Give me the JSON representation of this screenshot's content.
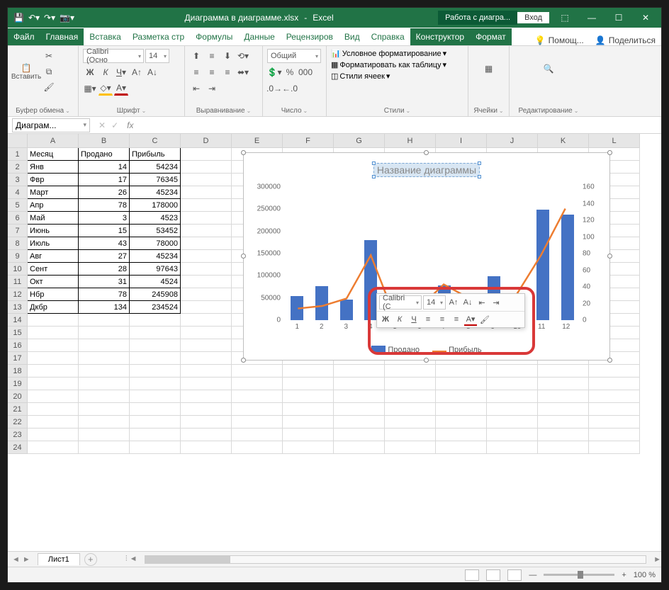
{
  "title": {
    "doc": "Диаграмма в диаграмме.xlsx",
    "app": "Excel",
    "context": "Работа с диагра...",
    "signin": "Вход"
  },
  "tabs": {
    "file": "Файл",
    "home": "Главная",
    "insert": "Вставка",
    "layout": "Разметка стр",
    "formulas": "Формулы",
    "data": "Данные",
    "review": "Рецензиров",
    "view": "Вид",
    "help": "Справка",
    "design": "Конструктор",
    "format": "Формат",
    "tell": "Помощ...",
    "share": "Поделиться"
  },
  "ribbon": {
    "clipboard": {
      "label": "Буфер обмена",
      "paste": "Вставить"
    },
    "font": {
      "label": "Шрифт",
      "name": "Calibri (Осно",
      "size": "14"
    },
    "align": {
      "label": "Выравнивание"
    },
    "number": {
      "label": "Число",
      "format": "Общий"
    },
    "styles": {
      "label": "Стили",
      "cond": "Условное форматирование",
      "table": "Форматировать как таблицу",
      "cell": "Стили ячеек"
    },
    "cells": {
      "label": "Ячейки"
    },
    "edit": {
      "label": "Редактирование"
    }
  },
  "namebox": "Диаграм...",
  "columns": [
    "A",
    "B",
    "C",
    "D",
    "E",
    "F",
    "G",
    "H",
    "I",
    "J",
    "K",
    "L"
  ],
  "table": {
    "headers": [
      "Месяц",
      "Продано",
      "Прибыль"
    ],
    "rows": [
      [
        "Янв",
        14,
        54234
      ],
      [
        "Фвр",
        17,
        76345
      ],
      [
        "Март",
        26,
        45234
      ],
      [
        "Апр",
        78,
        178000
      ],
      [
        "Май",
        3,
        4523
      ],
      [
        "Июнь",
        15,
        53452
      ],
      [
        "Июль",
        43,
        78000
      ],
      [
        "Авг",
        27,
        45234
      ],
      [
        "Сент",
        28,
        97643
      ],
      [
        "Окт",
        31,
        4524
      ],
      [
        "Нбр",
        78,
        245908
      ],
      [
        "Дкбр",
        134,
        234524
      ]
    ]
  },
  "chart_data": {
    "type": "combo",
    "title": "Название диаграммы",
    "x": [
      1,
      2,
      3,
      4,
      5,
      6,
      7,
      8,
      9,
      10,
      11,
      12
    ],
    "series": [
      {
        "name": "Продано",
        "type": "bar",
        "axis": "left",
        "values": [
          54234,
          76345,
          45234,
          178000,
          4523,
          53452,
          78000,
          45234,
          97643,
          4524,
          245908,
          234524
        ]
      },
      {
        "name": "Прибыль",
        "type": "line",
        "axis": "right",
        "values": [
          14,
          17,
          26,
          78,
          3,
          15,
          43,
          27,
          28,
          31,
          78,
          134
        ]
      }
    ],
    "y_left": {
      "min": 0,
      "max": 300000,
      "ticks": [
        0,
        50000,
        100000,
        150000,
        200000,
        250000,
        300000
      ]
    },
    "y_right": {
      "min": 0,
      "max": 160,
      "ticks": [
        0,
        20,
        40,
        60,
        80,
        100,
        120,
        140,
        160
      ]
    },
    "legend": [
      "Продано",
      "Прибыль"
    ],
    "colors": {
      "bar": "#4472c4",
      "line": "#ed7d31"
    }
  },
  "minibar": {
    "font": "Calibri (С",
    "size": "14"
  },
  "sheet": {
    "name": "Лист1"
  },
  "zoom": "100 %"
}
